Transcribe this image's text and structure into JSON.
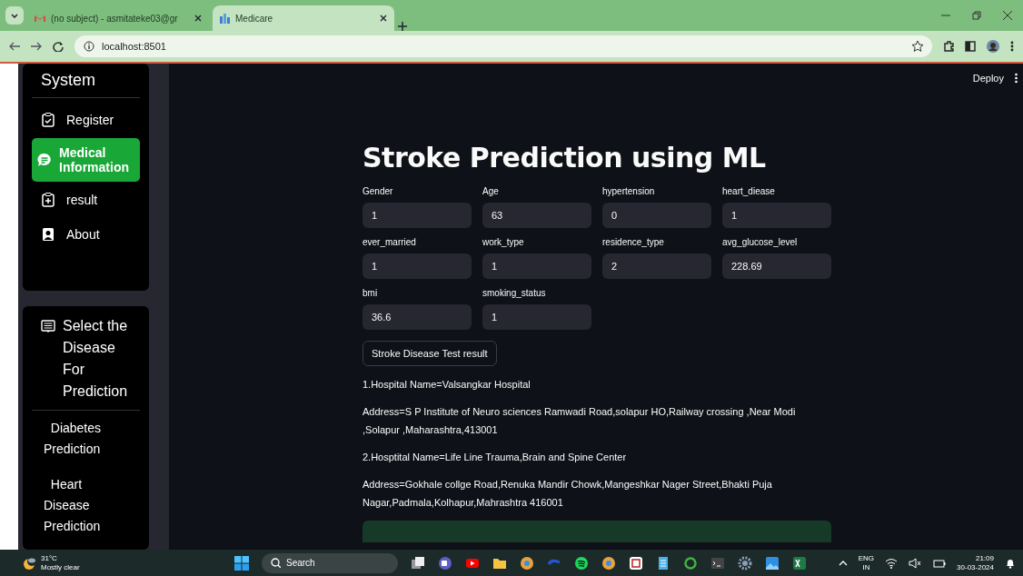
{
  "browser": {
    "tabs": [
      {
        "title": "(no subject) - asmitateke03@gr",
        "selected": false
      },
      {
        "title": "Medicare",
        "selected": true
      }
    ],
    "address": "localhost:8501"
  },
  "header": {
    "deploy": "Deploy"
  },
  "sidebar": {
    "menu_title": "System",
    "items": [
      {
        "label": "Register",
        "selected": false
      },
      {
        "label": "Medical Information",
        "selected": true
      },
      {
        "label": "result",
        "selected": false
      },
      {
        "label": "About",
        "selected": false
      }
    ],
    "disease_title": "Select the Disease For Prediction",
    "diseases": [
      {
        "label": "Diabetes Prediction"
      },
      {
        "label": "Heart Disease Prediction"
      }
    ]
  },
  "main": {
    "title": "Stroke Prediction using ML",
    "fields": [
      {
        "label": "Gender",
        "value": "1"
      },
      {
        "label": "Age",
        "value": "63"
      },
      {
        "label": "hypertension",
        "value": "0"
      },
      {
        "label": "heart_diease",
        "value": "1"
      },
      {
        "label": "ever_married",
        "value": "1"
      },
      {
        "label": "work_type",
        "value": "1"
      },
      {
        "label": "residence_type",
        "value": "2"
      },
      {
        "label": "avg_glucose_level",
        "value": "228.69"
      },
      {
        "label": "bmi",
        "value": "36.6"
      },
      {
        "label": "smoking_status",
        "value": "1"
      }
    ],
    "button": "Stroke Disease Test result",
    "results": [
      "1.Hospital Name=Valsangkar Hospital",
      "Address=S P Institute of Neuro sciences Ramwadi Road,solapur HO,Railway crossing ,Near Modi ,Solapur ,Maharashtra,413001",
      "2.Hosptital Name=Life Line Trauma,Brain and Spine Center",
      "Address=Gokhale collge Road,Renuka Mandir Chowk,Mangeshkar Nager Street,Bhakti Puja Nagar,Padmala,Kolhapur,Mahrashtra 416001"
    ]
  },
  "taskbar": {
    "temperature": "31°C",
    "weather": "Mostly clear",
    "search": "Search",
    "language": "ENG",
    "region": "IN",
    "time": "21:09",
    "date": "30-03-2024"
  }
}
